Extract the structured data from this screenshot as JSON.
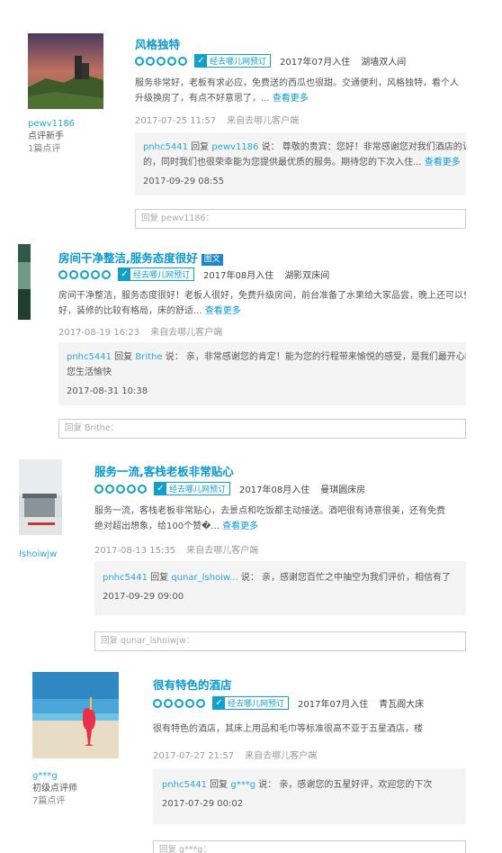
{
  "reviews": [
    {
      "user": {
        "name": "pewv1186",
        "level": "点评新手",
        "count": "1篇点评"
      },
      "title": "风格独特",
      "badge": "",
      "verified": "经去哪儿网预订",
      "checkin": "2017年07月入住",
      "room": "湖墙双人间",
      "body_l1": "服务非常好，老板有求必应，免费送的西瓜也很甜。交通便利，风格独特，看个人",
      "body_l2": "升级换房了，有点不好意思了，...",
      "more": "查看更多",
      "time": "2017-07-25 11:57",
      "source": "来自去哪儿客户端",
      "reply": {
        "from": "pnhc5441",
        "verb": "回复",
        "to": "pewv1186",
        "said": "说：",
        "l1": "尊敬的贵宾：您好！非常感谢您对我们酒店的认",
        "l2": "的，同时我们也很荣幸能为您提供最优质的服务。期待您的下次入住...",
        "more": "查看更多",
        "date": "2017-09-29 08:55"
      },
      "reply_box": "回复 pewv1186："
    },
    {
      "user": {
        "name": "",
        "level": "",
        "count": ""
      },
      "title": "房间干净整洁,服务态度很好",
      "badge": "图文",
      "verified": "经去哪儿网预订",
      "checkin": "2017年08月入住",
      "room": "湖影双床间",
      "body_l1": "房间干净整洁，服务态度很好！老板人很好，免费升级房间，前台准备了水果给大家品尝，晚上还可以免",
      "body_l2": "好，装修的比较有格局，床的舒适...",
      "more": "查看更多",
      "time": "2017-08-19 16:23",
      "source": "来自去哪儿客户端",
      "reply": {
        "from": "pnhc5441",
        "verb": "回复",
        "to": "Brithe",
        "said": "说：",
        "l1": "亲，非常感谢您的肯定！能为您的行程带来愉悦的感受，是我们最开心的",
        "l2": "您生活愉快",
        "more": "",
        "date": "2017-08-31 10:38"
      },
      "reply_box": "回复 Brithe："
    },
    {
      "user": {
        "name": "lshoiwjw",
        "level": "",
        "count": ""
      },
      "title": "服务一流,客栈老板非常贴心",
      "badge": "",
      "verified": "经去哪儿网预订",
      "checkin": "2017年08月入住",
      "room": "曼琪圆床房",
      "body_l1": "服务一流，客栈老板非常贴心，去景点和吃饭都主动接送。酒吧很有诗意很美，还有免费",
      "body_l2": "绝对超出想象，给100个赞�...",
      "more": "查看更多",
      "time": "2017-08-13 15:35",
      "source": "来自去哪儿客户端",
      "reply": {
        "from": "pnhc5441",
        "verb": "回复",
        "to": "qunar_lshoiw...",
        "said": "说：",
        "l1": "亲，感谢您百忙之中抽空为我们评价，相信有了",
        "l2": "",
        "more": "",
        "date": "2017-09-29 09:00"
      },
      "reply_box": "回复 qunar_lshoiwjw："
    },
    {
      "user": {
        "name": "g***g",
        "level": "初级点评师",
        "count": "7篇点评"
      },
      "title": "很有特色的酒店",
      "badge": "",
      "verified": "经去哪儿网预订",
      "checkin": "2017年07月入住",
      "room": "青瓦阁大床",
      "body_l1": "很有特色的酒店，其床上用品和毛巾等标准很高不亚于五星酒店，楼",
      "body_l2": "",
      "more": "",
      "time": "2017-07-27 21:57",
      "source": "来自去哪儿客户端",
      "reply": {
        "from": "pnhc5441",
        "verb": "回复",
        "to": "g***g",
        "said": "说：",
        "l1": "亲，感谢您的五星好评，欢迎您的下次",
        "l2": "",
        "more": "",
        "date": "2017-07-29 00:02"
      },
      "reply_box": "回复 g***g："
    }
  ]
}
